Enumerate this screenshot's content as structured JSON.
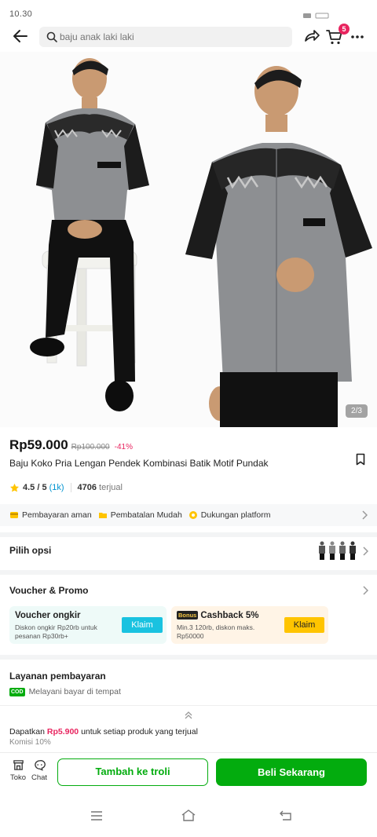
{
  "status_bar": {
    "time": "10.30"
  },
  "header": {
    "search_placeholder": "baju anak laki laki",
    "cart_count": "5"
  },
  "gallery": {
    "counter": "2/3"
  },
  "product": {
    "price": "Rp59.000",
    "original_price": "Rp100.000",
    "discount": "-41%",
    "title": "Baju Koko Pria Lengan Pendek Kombinasi Batik Motif Pundak",
    "rating": "4.5 / 5",
    "rating_count": "(1k)",
    "sold_count": "4706",
    "sold_label": "terjual"
  },
  "trust": {
    "items": [
      "Pembayaran aman",
      "Pembatalan Mudah",
      "Dukungan platform"
    ]
  },
  "options": {
    "label": "Pilih opsi"
  },
  "voucher_promo": {
    "title": "Voucher & Promo",
    "voucher1": {
      "title": "Voucher ongkir",
      "desc": "Diskon ongkir Rp20rb untuk pesanan Rp30rb+",
      "claim": "Klaim"
    },
    "voucher2": {
      "tag": "Bonus",
      "title": "Cashback 5%",
      "desc": "Min.3 120rb, diskon maks. Rp50000",
      "claim": "Klaim"
    }
  },
  "payment": {
    "title": "Layanan pembayaran",
    "cod_badge": "COD",
    "cod_text": "Melayani bayar di tempat"
  },
  "affiliate": {
    "prefix": "Dapatkan",
    "amount": "Rp5.900",
    "suffix": "untuk setiap produk yang terjual",
    "commission": "Komisi 10%"
  },
  "bottom_bar": {
    "toko": "Toko",
    "chat": "Chat",
    "add_cart": "Tambah ke troli",
    "buy_now": "Beli Sekarang"
  },
  "colors": {
    "primary_green": "#03ac0e",
    "accent_pink": "#e8245f",
    "link_blue": "#0094d1"
  }
}
